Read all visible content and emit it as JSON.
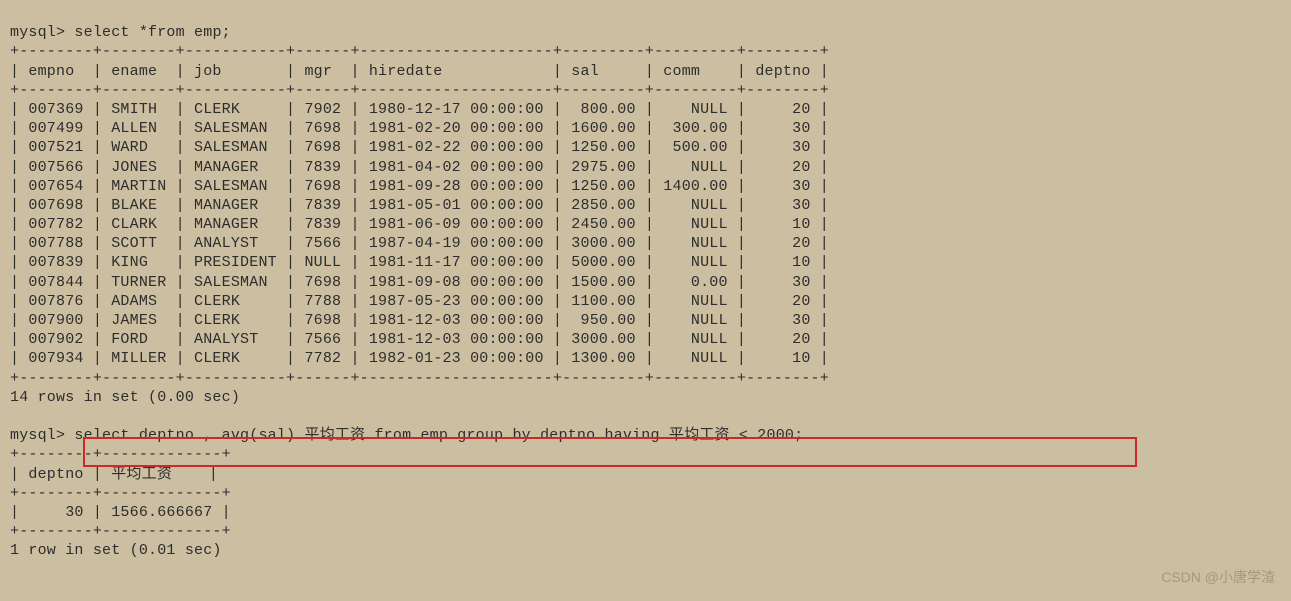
{
  "prompt": "mysql>",
  "query1": "select *from emp;",
  "border1": "+--------+--------+-----------+------+---------------------+---------+---------+--------+",
  "headers1": [
    "empno",
    "ename",
    "job",
    "mgr",
    "hiredate",
    "sal",
    "comm",
    "deptno"
  ],
  "rows1": [
    {
      "empno": "007369",
      "ename": "SMITH",
      "job": "CLERK",
      "mgr": "7902",
      "hiredate": "1980-12-17 00:00:00",
      "sal": "800.00",
      "comm": "NULL",
      "deptno": "20"
    },
    {
      "empno": "007499",
      "ename": "ALLEN",
      "job": "SALESMAN",
      "mgr": "7698",
      "hiredate": "1981-02-20 00:00:00",
      "sal": "1600.00",
      "comm": "300.00",
      "deptno": "30"
    },
    {
      "empno": "007521",
      "ename": "WARD",
      "job": "SALESMAN",
      "mgr": "7698",
      "hiredate": "1981-02-22 00:00:00",
      "sal": "1250.00",
      "comm": "500.00",
      "deptno": "30"
    },
    {
      "empno": "007566",
      "ename": "JONES",
      "job": "MANAGER",
      "mgr": "7839",
      "hiredate": "1981-04-02 00:00:00",
      "sal": "2975.00",
      "comm": "NULL",
      "deptno": "20"
    },
    {
      "empno": "007654",
      "ename": "MARTIN",
      "job": "SALESMAN",
      "mgr": "7698",
      "hiredate": "1981-09-28 00:00:00",
      "sal": "1250.00",
      "comm": "1400.00",
      "deptno": "30"
    },
    {
      "empno": "007698",
      "ename": "BLAKE",
      "job": "MANAGER",
      "mgr": "7839",
      "hiredate": "1981-05-01 00:00:00",
      "sal": "2850.00",
      "comm": "NULL",
      "deptno": "30"
    },
    {
      "empno": "007782",
      "ename": "CLARK",
      "job": "MANAGER",
      "mgr": "7839",
      "hiredate": "1981-06-09 00:00:00",
      "sal": "2450.00",
      "comm": "NULL",
      "deptno": "10"
    },
    {
      "empno": "007788",
      "ename": "SCOTT",
      "job": "ANALYST",
      "mgr": "7566",
      "hiredate": "1987-04-19 00:00:00",
      "sal": "3000.00",
      "comm": "NULL",
      "deptno": "20"
    },
    {
      "empno": "007839",
      "ename": "KING",
      "job": "PRESIDENT",
      "mgr": "NULL",
      "hiredate": "1981-11-17 00:00:00",
      "sal": "5000.00",
      "comm": "NULL",
      "deptno": "10"
    },
    {
      "empno": "007844",
      "ename": "TURNER",
      "job": "SALESMAN",
      "mgr": "7698",
      "hiredate": "1981-09-08 00:00:00",
      "sal": "1500.00",
      "comm": "0.00",
      "deptno": "30"
    },
    {
      "empno": "007876",
      "ename": "ADAMS",
      "job": "CLERK",
      "mgr": "7788",
      "hiredate": "1987-05-23 00:00:00",
      "sal": "1100.00",
      "comm": "NULL",
      "deptno": "20"
    },
    {
      "empno": "007900",
      "ename": "JAMES",
      "job": "CLERK",
      "mgr": "7698",
      "hiredate": "1981-12-03 00:00:00",
      "sal": "950.00",
      "comm": "NULL",
      "deptno": "30"
    },
    {
      "empno": "007902",
      "ename": "FORD",
      "job": "ANALYST",
      "mgr": "7566",
      "hiredate": "1981-12-03 00:00:00",
      "sal": "3000.00",
      "comm": "NULL",
      "deptno": "20"
    },
    {
      "empno": "007934",
      "ename": "MILLER",
      "job": "CLERK",
      "mgr": "7782",
      "hiredate": "1982-01-23 00:00:00",
      "sal": "1300.00",
      "comm": "NULL",
      "deptno": "10"
    }
  ],
  "footer1": "14 rows in set (0.00 sec)",
  "query2": "select deptno , avg(sal) 平均工资 from emp group by deptno having 平均工资 < 2000;",
  "border2": "+--------+-------------+",
  "headers2": [
    "deptno",
    "平均工资"
  ],
  "rows2": [
    {
      "deptno": "30",
      "avg": "1566.666667"
    }
  ],
  "footer2": "1 row in set (0.01 sec)",
  "watermark": "CSDN @小唐学渣"
}
